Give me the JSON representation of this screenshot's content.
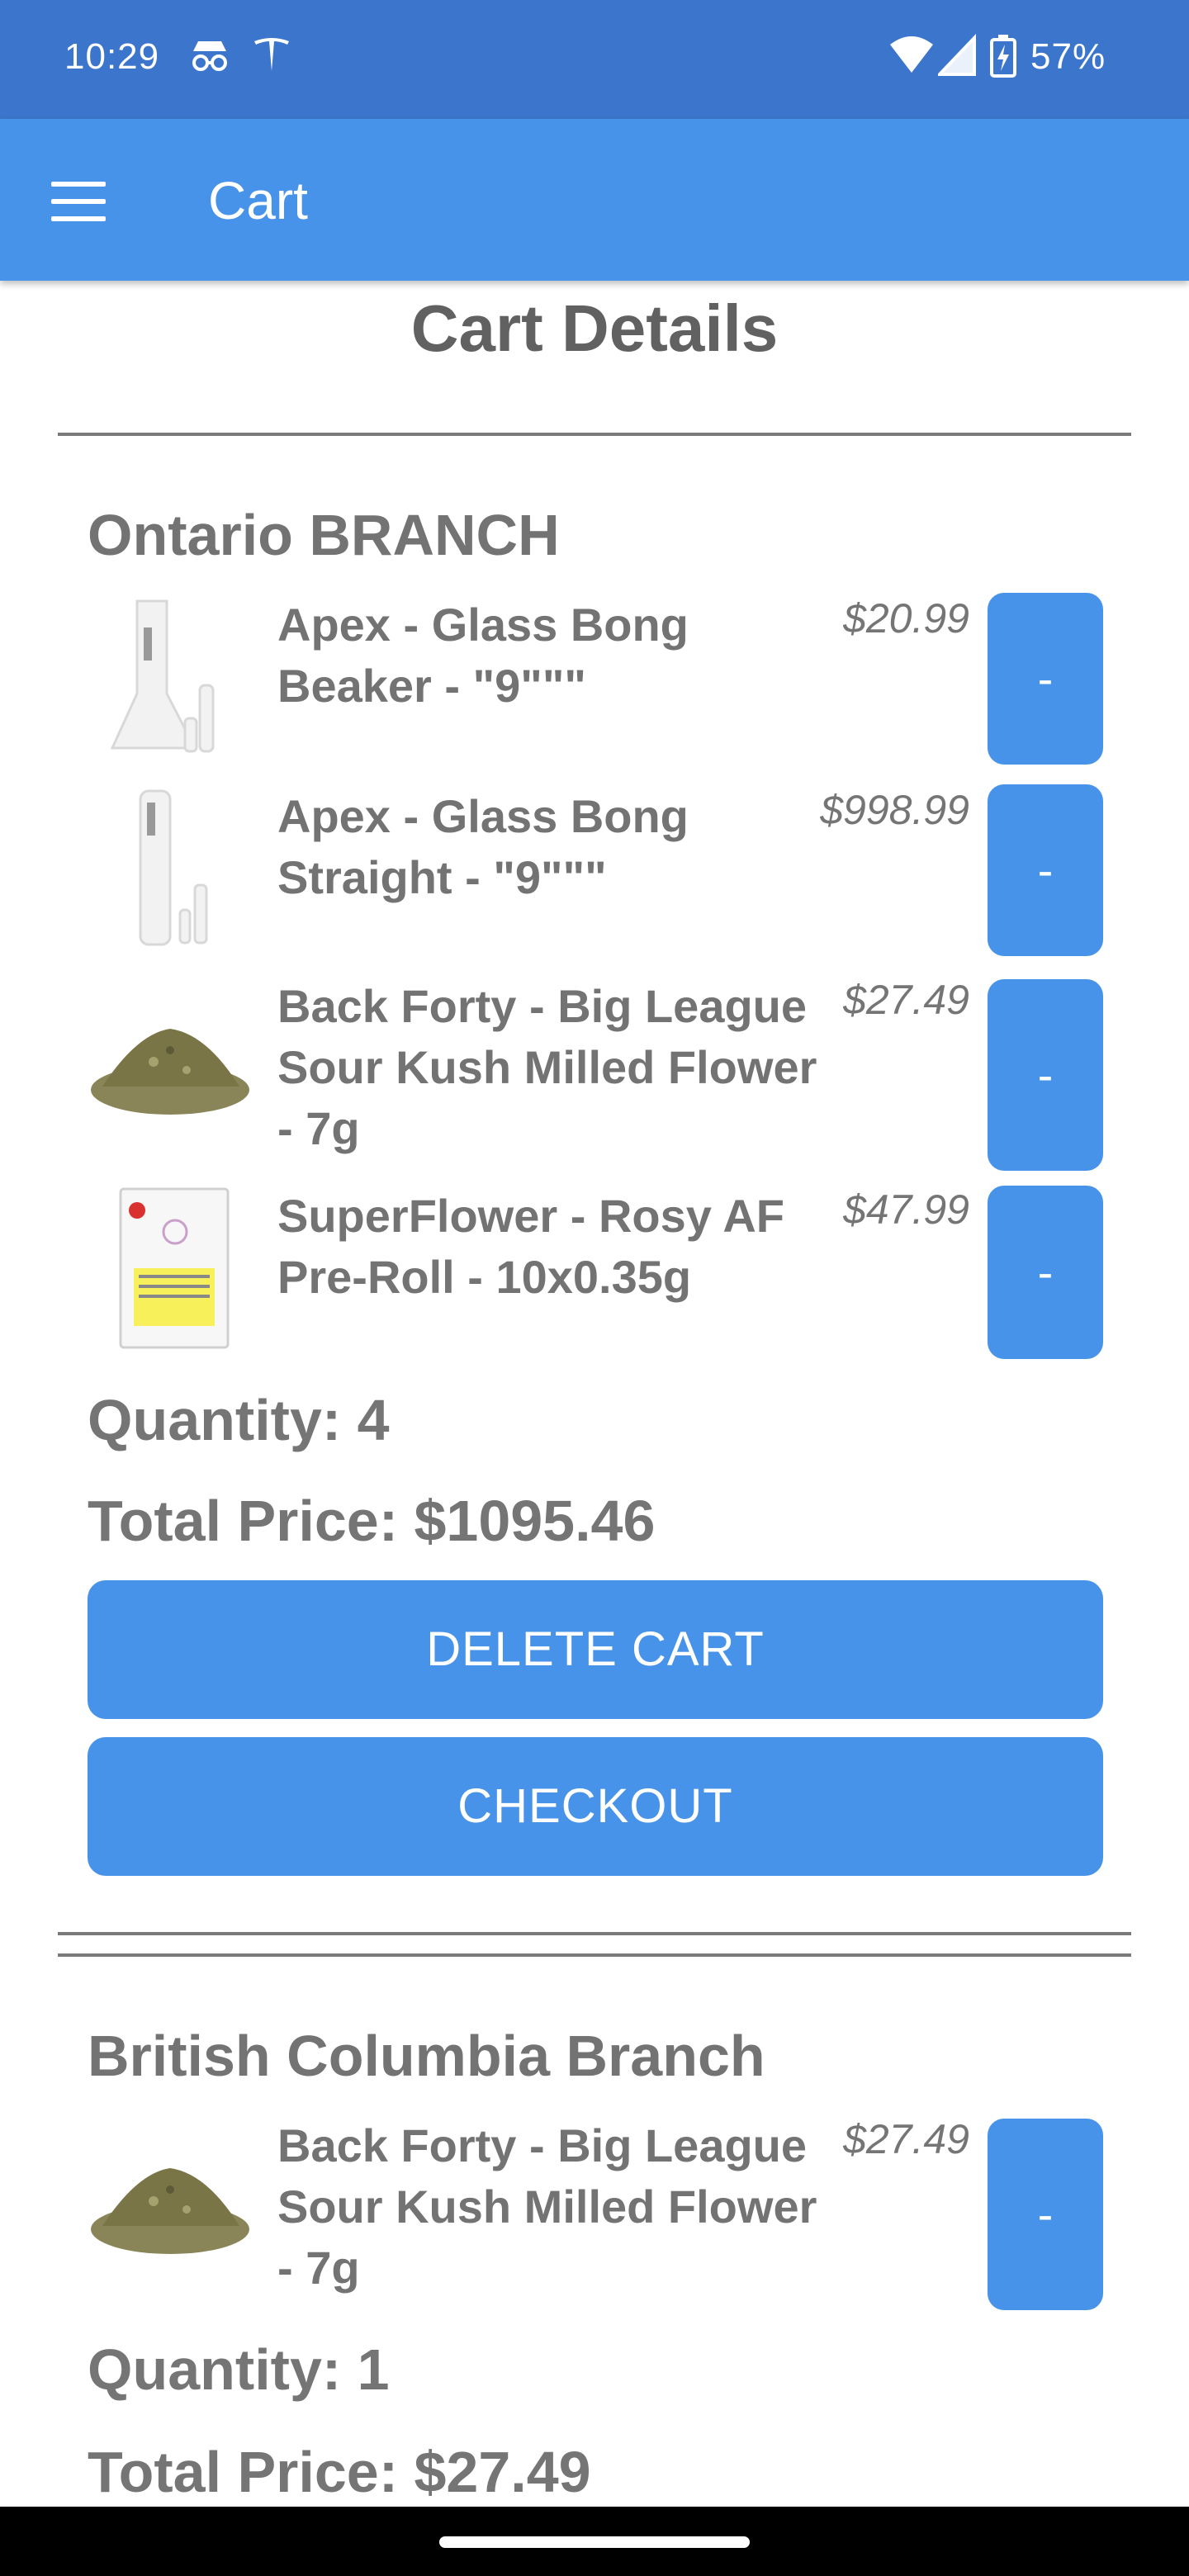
{
  "status_bar": {
    "time": "10:29",
    "battery": "57%",
    "icons": [
      "incognito-icon",
      "tesla-icon",
      "wifi-icon",
      "signal-icon",
      "battery-charging-icon"
    ]
  },
  "app_bar": {
    "title": "Cart",
    "menu_icon": "hamburger-menu-icon"
  },
  "page": {
    "title": "Cart Details"
  },
  "branches": [
    {
      "name": "Ontario BRANCH",
      "items": [
        {
          "name": "Apex - Glass Bong Beaker - \"9\"\"\"",
          "price": "$20.99",
          "remove_label": "-",
          "image": "beaker-bong-image"
        },
        {
          "name": "Apex - Glass Bong Straight - \"9\"\"\"",
          "price": "$998.99",
          "remove_label": "-",
          "image": "straight-bong-image"
        },
        {
          "name": "Back Forty - Big League Sour Kush Milled Flower - 7g",
          "price": "$27.49",
          "remove_label": "-",
          "image": "milled-flower-image"
        },
        {
          "name": "SuperFlower - Rosy AF Pre-Roll - 10x0.35g",
          "price": "$47.99",
          "remove_label": "-",
          "image": "pre-roll-package-image"
        }
      ],
      "quantity": "Quantity: 4",
      "total": "Total Price: $1095.46",
      "delete_label": "DELETE CART",
      "checkout_label": "CHECKOUT"
    },
    {
      "name": "British Columbia Branch",
      "items": [
        {
          "name": "Back Forty - Big League Sour Kush Milled Flower - 7g",
          "price": "$27.49",
          "remove_label": "-",
          "image": "milled-flower-image"
        }
      ],
      "quantity": "Quantity: 1",
      "total": "Total Price: $27.49"
    }
  ],
  "colors": {
    "status_bar": "#3b76cc",
    "app_bar": "#4893ea",
    "button": "#4893ea",
    "text": "#757575"
  }
}
